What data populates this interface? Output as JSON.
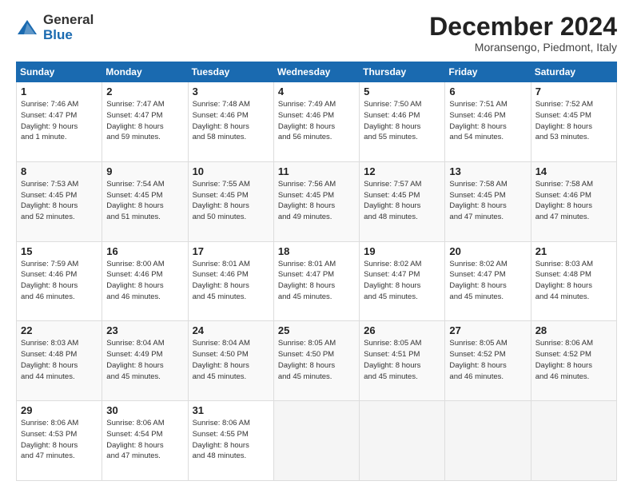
{
  "header": {
    "logo_general": "General",
    "logo_blue": "Blue",
    "month_title": "December 2024",
    "location": "Moransengo, Piedmont, Italy"
  },
  "weekdays": [
    "Sunday",
    "Monday",
    "Tuesday",
    "Wednesday",
    "Thursday",
    "Friday",
    "Saturday"
  ],
  "weeks": [
    [
      {
        "day": "1",
        "info": "Sunrise: 7:46 AM\nSunset: 4:47 PM\nDaylight: 9 hours\nand 1 minute."
      },
      {
        "day": "2",
        "info": "Sunrise: 7:47 AM\nSunset: 4:47 PM\nDaylight: 8 hours\nand 59 minutes."
      },
      {
        "day": "3",
        "info": "Sunrise: 7:48 AM\nSunset: 4:46 PM\nDaylight: 8 hours\nand 58 minutes."
      },
      {
        "day": "4",
        "info": "Sunrise: 7:49 AM\nSunset: 4:46 PM\nDaylight: 8 hours\nand 56 minutes."
      },
      {
        "day": "5",
        "info": "Sunrise: 7:50 AM\nSunset: 4:46 PM\nDaylight: 8 hours\nand 55 minutes."
      },
      {
        "day": "6",
        "info": "Sunrise: 7:51 AM\nSunset: 4:46 PM\nDaylight: 8 hours\nand 54 minutes."
      },
      {
        "day": "7",
        "info": "Sunrise: 7:52 AM\nSunset: 4:45 PM\nDaylight: 8 hours\nand 53 minutes."
      }
    ],
    [
      {
        "day": "8",
        "info": "Sunrise: 7:53 AM\nSunset: 4:45 PM\nDaylight: 8 hours\nand 52 minutes."
      },
      {
        "day": "9",
        "info": "Sunrise: 7:54 AM\nSunset: 4:45 PM\nDaylight: 8 hours\nand 51 minutes."
      },
      {
        "day": "10",
        "info": "Sunrise: 7:55 AM\nSunset: 4:45 PM\nDaylight: 8 hours\nand 50 minutes."
      },
      {
        "day": "11",
        "info": "Sunrise: 7:56 AM\nSunset: 4:45 PM\nDaylight: 8 hours\nand 49 minutes."
      },
      {
        "day": "12",
        "info": "Sunrise: 7:57 AM\nSunset: 4:45 PM\nDaylight: 8 hours\nand 48 minutes."
      },
      {
        "day": "13",
        "info": "Sunrise: 7:58 AM\nSunset: 4:45 PM\nDaylight: 8 hours\nand 47 minutes."
      },
      {
        "day": "14",
        "info": "Sunrise: 7:58 AM\nSunset: 4:46 PM\nDaylight: 8 hours\nand 47 minutes."
      }
    ],
    [
      {
        "day": "15",
        "info": "Sunrise: 7:59 AM\nSunset: 4:46 PM\nDaylight: 8 hours\nand 46 minutes."
      },
      {
        "day": "16",
        "info": "Sunrise: 8:00 AM\nSunset: 4:46 PM\nDaylight: 8 hours\nand 46 minutes."
      },
      {
        "day": "17",
        "info": "Sunrise: 8:01 AM\nSunset: 4:46 PM\nDaylight: 8 hours\nand 45 minutes."
      },
      {
        "day": "18",
        "info": "Sunrise: 8:01 AM\nSunset: 4:47 PM\nDaylight: 8 hours\nand 45 minutes."
      },
      {
        "day": "19",
        "info": "Sunrise: 8:02 AM\nSunset: 4:47 PM\nDaylight: 8 hours\nand 45 minutes."
      },
      {
        "day": "20",
        "info": "Sunrise: 8:02 AM\nSunset: 4:47 PM\nDaylight: 8 hours\nand 45 minutes."
      },
      {
        "day": "21",
        "info": "Sunrise: 8:03 AM\nSunset: 4:48 PM\nDaylight: 8 hours\nand 44 minutes."
      }
    ],
    [
      {
        "day": "22",
        "info": "Sunrise: 8:03 AM\nSunset: 4:48 PM\nDaylight: 8 hours\nand 44 minutes."
      },
      {
        "day": "23",
        "info": "Sunrise: 8:04 AM\nSunset: 4:49 PM\nDaylight: 8 hours\nand 45 minutes."
      },
      {
        "day": "24",
        "info": "Sunrise: 8:04 AM\nSunset: 4:50 PM\nDaylight: 8 hours\nand 45 minutes."
      },
      {
        "day": "25",
        "info": "Sunrise: 8:05 AM\nSunset: 4:50 PM\nDaylight: 8 hours\nand 45 minutes."
      },
      {
        "day": "26",
        "info": "Sunrise: 8:05 AM\nSunset: 4:51 PM\nDaylight: 8 hours\nand 45 minutes."
      },
      {
        "day": "27",
        "info": "Sunrise: 8:05 AM\nSunset: 4:52 PM\nDaylight: 8 hours\nand 46 minutes."
      },
      {
        "day": "28",
        "info": "Sunrise: 8:06 AM\nSunset: 4:52 PM\nDaylight: 8 hours\nand 46 minutes."
      }
    ],
    [
      {
        "day": "29",
        "info": "Sunrise: 8:06 AM\nSunset: 4:53 PM\nDaylight: 8 hours\nand 47 minutes."
      },
      {
        "day": "30",
        "info": "Sunrise: 8:06 AM\nSunset: 4:54 PM\nDaylight: 8 hours\nand 47 minutes."
      },
      {
        "day": "31",
        "info": "Sunrise: 8:06 AM\nSunset: 4:55 PM\nDaylight: 8 hours\nand 48 minutes."
      },
      null,
      null,
      null,
      null
    ]
  ]
}
